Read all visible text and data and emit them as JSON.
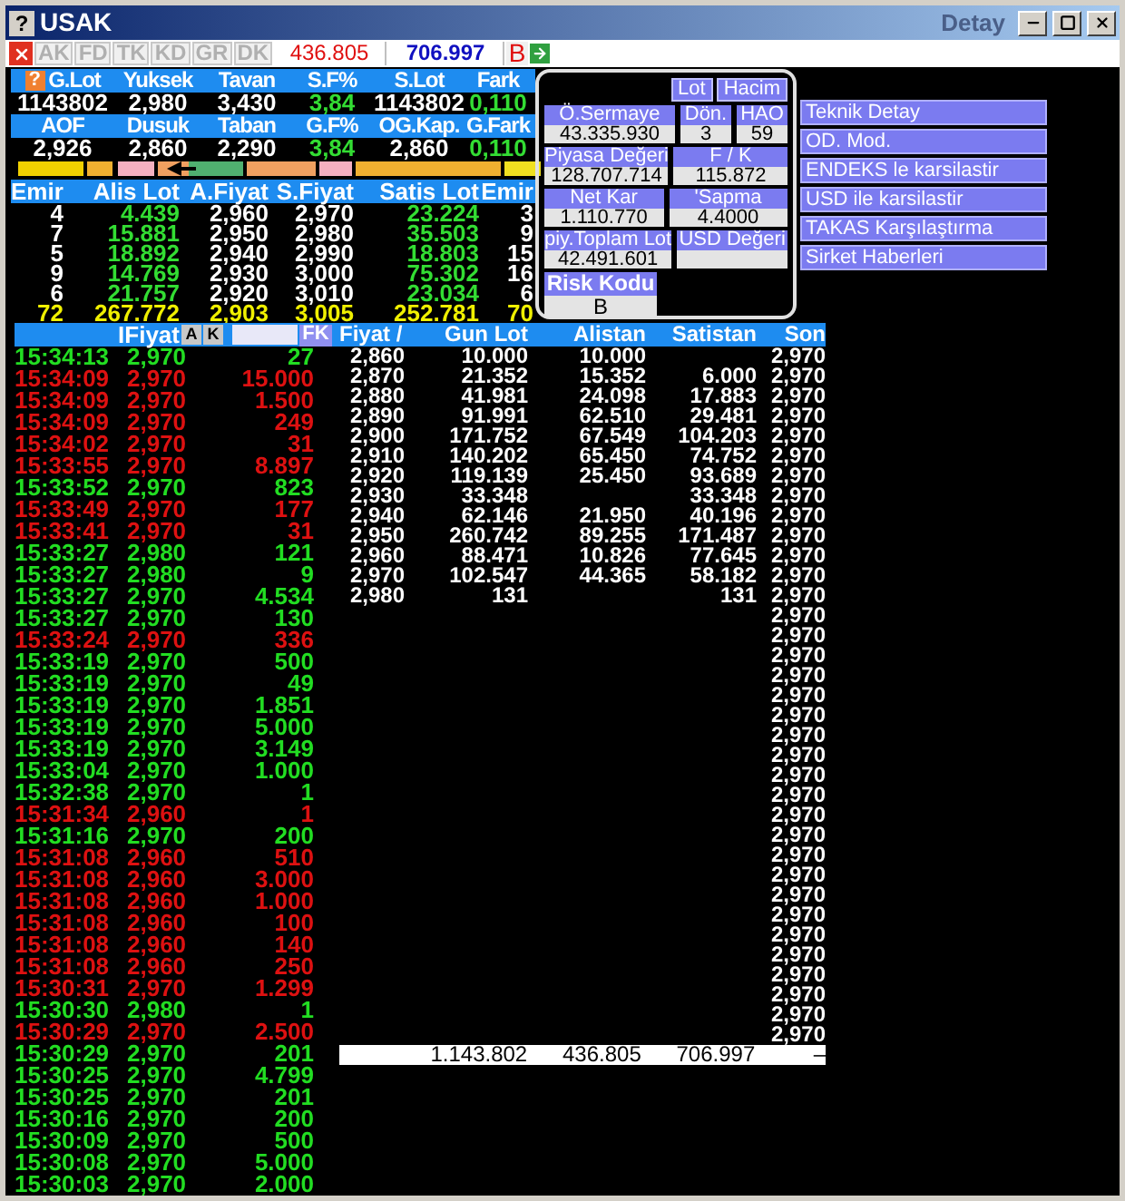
{
  "window": {
    "help": "?",
    "title": "USAK",
    "subtitle": "Detay"
  },
  "toolbar": {
    "buttons": [
      "AK",
      "FD",
      "TK",
      "KD",
      "GR",
      "DK"
    ],
    "sell_total": "436.805",
    "buy_total": "706.997",
    "flag": "B"
  },
  "stats": {
    "help": "?",
    "blocks": [
      {
        "columns": [
          "G.Lot",
          "Yuksek",
          "Tavan",
          "S.F%",
          "S.Lot",
          "Fark"
        ],
        "values": [
          "1143802",
          "2,980",
          "3,430",
          "3,84",
          "1143802",
          "0,110"
        ]
      },
      {
        "columns": [
          "AOF",
          "Dusuk",
          "Taban",
          "G.F%",
          "OG.Kap.",
          "G.Fark"
        ],
        "values": [
          "2,926",
          "2,860",
          "2,290",
          "3,84",
          "2,860",
          "0,110"
        ]
      }
    ]
  },
  "depth": {
    "columns": [
      "Emir",
      "Alis Lot",
      "A.Fiyat",
      "S.Fiyat",
      "Satis Lot",
      "Emir"
    ],
    "rows": [
      [
        "4",
        "4.439",
        "2,960",
        "2,970",
        "23.224",
        "3"
      ],
      [
        "7",
        "15.881",
        "2,950",
        "2,980",
        "35.503",
        "9"
      ],
      [
        "5",
        "18.892",
        "2,940",
        "2,990",
        "18.803",
        "15"
      ],
      [
        "9",
        "14.769",
        "2,930",
        "3,000",
        "75.302",
        "16"
      ],
      [
        "6",
        "21.757",
        "2,920",
        "3,010",
        "23.034",
        "6"
      ]
    ],
    "total": [
      "72",
      "267.772",
      "2,903",
      "3,005",
      "252.781",
      "70"
    ]
  },
  "quote": {
    "buttons": [
      "Lot",
      "Hacim"
    ],
    "rows": [
      [
        {
          "label": "Ö.Sermaye",
          "value": "43.335.930"
        },
        {
          "label": "Dön.",
          "value": "3"
        },
        {
          "label": "HAO",
          "value": "59"
        }
      ],
      [
        {
          "label": "Piyasa Değeri",
          "value": "128.707.714"
        },
        {
          "label": "F / K",
          "value": "115.872"
        }
      ],
      [
        {
          "label": "Net Kar",
          "value": "1.110.770"
        },
        {
          "label": "'Sapma",
          "value": "4.4000"
        }
      ],
      [
        {
          "label": "piy.Toplam Lot",
          "value": "42.491.601"
        },
        {
          "label": "USD Değeri"
        }
      ]
    ],
    "risk": {
      "label": "Risk Kodu",
      "value": "B"
    }
  },
  "actions": [
    "Teknik Detay",
    "OD. Mod.",
    "ENDEKS le karsilastir",
    "USD ile karsilastir",
    "TAKAS Karşılaştırma",
    "Sirket Haberleri"
  ],
  "trades": {
    "label": "IFiyat",
    "buttons": [
      "A",
      "K"
    ],
    "fk": "FK",
    "rows": [
      {
        "time": "15:34:13",
        "price": "2,970",
        "lot": "27",
        "color": "#22dd22"
      },
      {
        "time": "15:34:09",
        "price": "2,970",
        "lot": "15.000",
        "color": "#dd1111"
      },
      {
        "time": "15:34:09",
        "price": "2,970",
        "lot": "1.500",
        "color": "#dd1111"
      },
      {
        "time": "15:34:09",
        "price": "2,970",
        "lot": "249",
        "color": "#dd1111"
      },
      {
        "time": "15:34:02",
        "price": "2,970",
        "lot": "31",
        "color": "#dd1111"
      },
      {
        "time": "15:33:55",
        "price": "2,970",
        "lot": "8.897",
        "color": "#dd1111"
      },
      {
        "time": "15:33:52",
        "price": "2,970",
        "lot": "823",
        "color": "#22dd22"
      },
      {
        "time": "15:33:49",
        "price": "2,970",
        "lot": "177",
        "color": "#dd1111"
      },
      {
        "time": "15:33:41",
        "price": "2,970",
        "lot": "31",
        "color": "#dd1111"
      },
      {
        "time": "15:33:27",
        "price": "2,980",
        "lot": "121",
        "color": "#22dd22"
      },
      {
        "time": "15:33:27",
        "price": "2,980",
        "lot": "9",
        "color": "#22dd22"
      },
      {
        "time": "15:33:27",
        "price": "2,970",
        "lot": "4.534",
        "color": "#22dd22"
      },
      {
        "time": "15:33:27",
        "price": "2,970",
        "lot": "130",
        "color": "#22dd22"
      },
      {
        "time": "15:33:24",
        "price": "2,970",
        "lot": "336",
        "color": "#dd1111"
      },
      {
        "time": "15:33:19",
        "price": "2,970",
        "lot": "500",
        "color": "#22dd22"
      },
      {
        "time": "15:33:19",
        "price": "2,970",
        "lot": "49",
        "color": "#22dd22"
      },
      {
        "time": "15:33:19",
        "price": "2,970",
        "lot": "1.851",
        "color": "#22dd22"
      },
      {
        "time": "15:33:19",
        "price": "2,970",
        "lot": "5.000",
        "color": "#22dd22"
      },
      {
        "time": "15:33:19",
        "price": "2,970",
        "lot": "3.149",
        "color": "#22dd22"
      },
      {
        "time": "15:33:04",
        "price": "2,970",
        "lot": "1.000",
        "color": "#22dd22"
      },
      {
        "time": "15:32:38",
        "price": "2,970",
        "lot": "1",
        "color": "#22dd22"
      },
      {
        "time": "15:31:34",
        "price": "2,960",
        "lot": "1",
        "color": "#dd1111"
      },
      {
        "time": "15:31:16",
        "price": "2,970",
        "lot": "200",
        "color": "#22dd22"
      },
      {
        "time": "15:31:08",
        "price": "2,960",
        "lot": "510",
        "color": "#dd1111"
      },
      {
        "time": "15:31:08",
        "price": "2,960",
        "lot": "3.000",
        "color": "#dd1111"
      },
      {
        "time": "15:31:08",
        "price": "2,960",
        "lot": "1.000",
        "color": "#dd1111"
      },
      {
        "time": "15:31:08",
        "price": "2,960",
        "lot": "100",
        "color": "#dd1111"
      },
      {
        "time": "15:31:08",
        "price": "2,960",
        "lot": "140",
        "color": "#dd1111"
      },
      {
        "time": "15:31:08",
        "price": "2,960",
        "lot": "250",
        "color": "#dd1111"
      },
      {
        "time": "15:30:31",
        "price": "2,970",
        "lot": "1.299",
        "color": "#dd1111"
      },
      {
        "time": "15:30:30",
        "price": "2,980",
        "lot": "1",
        "color": "#22dd22"
      },
      {
        "time": "15:30:29",
        "price": "2,970",
        "lot": "2.500",
        "color": "#dd1111"
      },
      {
        "time": "15:30:29",
        "price": "2,970",
        "lot": "201",
        "color": "#22dd22"
      },
      {
        "time": "15:30:25",
        "price": "2,970",
        "lot": "4.799",
        "color": "#22dd22"
      },
      {
        "time": "15:30:25",
        "price": "2,970",
        "lot": "201",
        "color": "#22dd22"
      },
      {
        "time": "15:30:16",
        "price": "2,970",
        "lot": "200",
        "color": "#22dd22"
      },
      {
        "time": "15:30:09",
        "price": "2,970",
        "lot": "500",
        "color": "#22dd22"
      },
      {
        "time": "15:30:08",
        "price": "2,970",
        "lot": "5.000",
        "color": "#22dd22"
      },
      {
        "time": "15:30:03",
        "price": "2,970",
        "lot": "2.000",
        "color": "#22dd22"
      }
    ]
  },
  "levels": {
    "columns": [
      "Fiyat /",
      "Gun Lot",
      "Alistan",
      "Satistan",
      "Son"
    ],
    "rows": [
      {
        "fiyat": "2,860",
        "gun_lot": "10.000",
        "alistan": "10.000",
        "son": "2,970"
      },
      {
        "fiyat": "2,870",
        "gun_lot": "21.352",
        "alistan": "15.352",
        "satistan": "6.000",
        "son": "2,970"
      },
      {
        "fiyat": "2,880",
        "gun_lot": "41.981",
        "alistan": "24.098",
        "satistan": "17.883",
        "son": "2,970"
      },
      {
        "fiyat": "2,890",
        "gun_lot": "91.991",
        "alistan": "62.510",
        "satistan": "29.481",
        "son": "2,970"
      },
      {
        "fiyat": "2,900",
        "gun_lot": "171.752",
        "alistan": "67.549",
        "satistan": "104.203",
        "son": "2,970"
      },
      {
        "fiyat": "2,910",
        "gun_lot": "140.202",
        "alistan": "65.450",
        "satistan": "74.752",
        "son": "2,970"
      },
      {
        "fiyat": "2,920",
        "gun_lot": "119.139",
        "alistan": "25.450",
        "satistan": "93.689",
        "son": "2,970"
      },
      {
        "fiyat": "2,930",
        "gun_lot": "33.348",
        "satistan": "33.348",
        "son": "2,970"
      },
      {
        "fiyat": "2,940",
        "gun_lot": "62.146",
        "alistan": "21.950",
        "satistan": "40.196",
        "son": "2,970"
      },
      {
        "fiyat": "2,950",
        "gun_lot": "260.742",
        "alistan": "89.255",
        "satistan": "171.487",
        "son": "2,970"
      },
      {
        "fiyat": "2,960",
        "gun_lot": "88.471",
        "alistan": "10.826",
        "satistan": "77.645",
        "son": "2,970"
      },
      {
        "fiyat": "2,970",
        "gun_lot": "102.547",
        "alistan": "44.365",
        "satistan": "58.182",
        "son": "2,970"
      },
      {
        "fiyat": "2,980",
        "gun_lot": "131",
        "satistan": "131",
        "son": "2,970"
      },
      {
        "son": "2,970"
      },
      {
        "son": "2,970"
      },
      {
        "son": "2,970"
      },
      {
        "son": "2,970"
      },
      {
        "son": "2,970"
      },
      {
        "son": "2,970"
      },
      {
        "son": "2,970"
      },
      {
        "son": "2,970"
      },
      {
        "son": "2,970"
      },
      {
        "son": "2,970"
      },
      {
        "son": "2,970"
      },
      {
        "son": "2,970"
      },
      {
        "son": "2,970"
      },
      {
        "son": "2,970"
      },
      {
        "son": "2,970"
      },
      {
        "son": "2,970"
      },
      {
        "son": "2,970"
      },
      {
        "son": "2,970"
      },
      {
        "son": "2,970"
      },
      {
        "son": "2,970"
      },
      {
        "son": "2,970"
      },
      {
        "son": "2,970"
      }
    ],
    "totals": [
      "1.143.802",
      "436.805",
      "706.997",
      "–"
    ]
  }
}
